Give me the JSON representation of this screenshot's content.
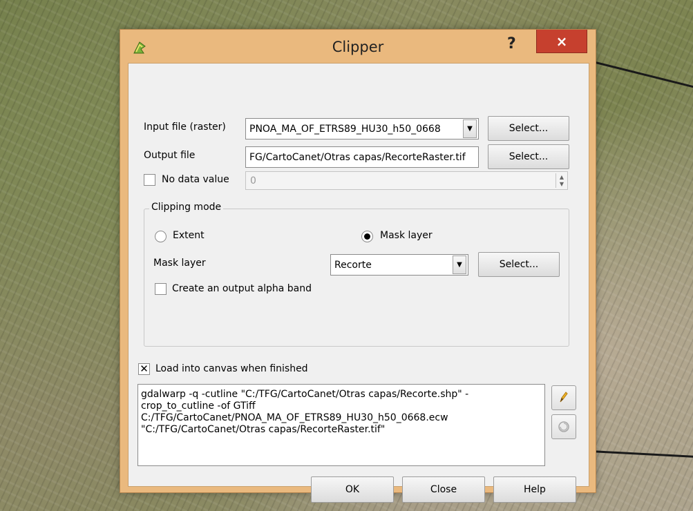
{
  "dialog": {
    "title": "Clipper",
    "help_label": "?",
    "close_label": "×"
  },
  "input": {
    "label": "Input file (raster)",
    "value": "PNOA_MA_OF_ETRS89_HU30_h50_0668",
    "select_label": "Select..."
  },
  "output": {
    "label": "Output file",
    "value": "FG/CartoCanet/Otras capas/RecorteRaster.tif",
    "select_label": "Select..."
  },
  "nodata": {
    "label": "No data value",
    "checked": false,
    "value": "0"
  },
  "clipping": {
    "title": "Clipping mode",
    "extent_label": "Extent",
    "mask_label": "Mask layer",
    "selected_mode": "Mask layer",
    "mask_layer_label": "Mask layer",
    "mask_layer_value": "Recorte",
    "select_label": "Select...",
    "alpha_label": "Create an output alpha band",
    "alpha_checked": false
  },
  "load": {
    "label": "Load into canvas when finished",
    "checked": true,
    "check_mark": "✕"
  },
  "command": {
    "text": "gdalwarp -q -cutline \"C:/TFG/CartoCanet/Otras capas/Recorte.shp\" -\ncrop_to_cutline -of GTiff\nC:/TFG/CartoCanet/PNOA_MA_OF_ETRS89_HU30_h50_0668.ecw\n\"C:/TFG/CartoCanet/Otras capas/RecorteRaster.tif\""
  },
  "buttons": {
    "ok": "OK",
    "close": "Close",
    "help": "Help"
  },
  "icons": {
    "app": "qgis-clipper-icon",
    "edit": "pencil-icon",
    "reset": "reset-icon",
    "dropdown": "▼",
    "spin_up": "▲",
    "spin_down": "▼"
  },
  "colors": {
    "title_bar": "#eab97e",
    "close_button": "#c6402e",
    "client_bg": "#f0f0f0"
  }
}
